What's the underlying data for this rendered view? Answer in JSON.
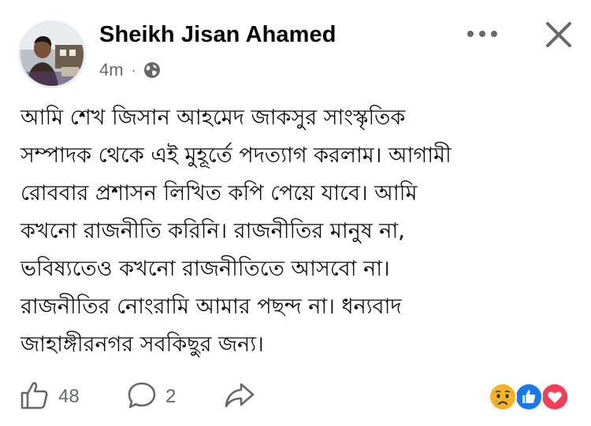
{
  "post": {
    "author": "Sheikh Jisan Ahamed",
    "time": "4m",
    "separator": "·",
    "privacy_icon": "globe-icon",
    "body_lines": [
      "আমি শেখ জিসান আহমেদ জাকসুর সাংস্কৃতিক",
      "সম্পাদক থেকে এই মুহূর্তে পদত্যাগ করলাম। আগামী",
      "রোববার প্রশাসন লিখিত কপি পেয়ে যাবে। আমি",
      "কখনো রাজনীতি করিনি। রাজনীতির মানুষ না,",
      "ভবিষ্যতেও কখনো রাজনীতিতে আসবো না।",
      "রাজনীতির নোংরামি আমার পছন্দ না। ধন্যবাদ",
      "জাহাঙ্গীরনগর সবকিছুর জন্য।"
    ]
  },
  "toolbar": {
    "more_icon": "more-options-icon",
    "close_icon": "close-icon"
  },
  "footer": {
    "like_count": "48",
    "comment_count": "2",
    "reactions": [
      "sad",
      "like",
      "love"
    ]
  },
  "colors": {
    "text": "#050505",
    "secondary": "#65676b",
    "like_blue": "#1877f2",
    "love_red": "#f33e58",
    "sad_yellow": "#f7b125"
  }
}
